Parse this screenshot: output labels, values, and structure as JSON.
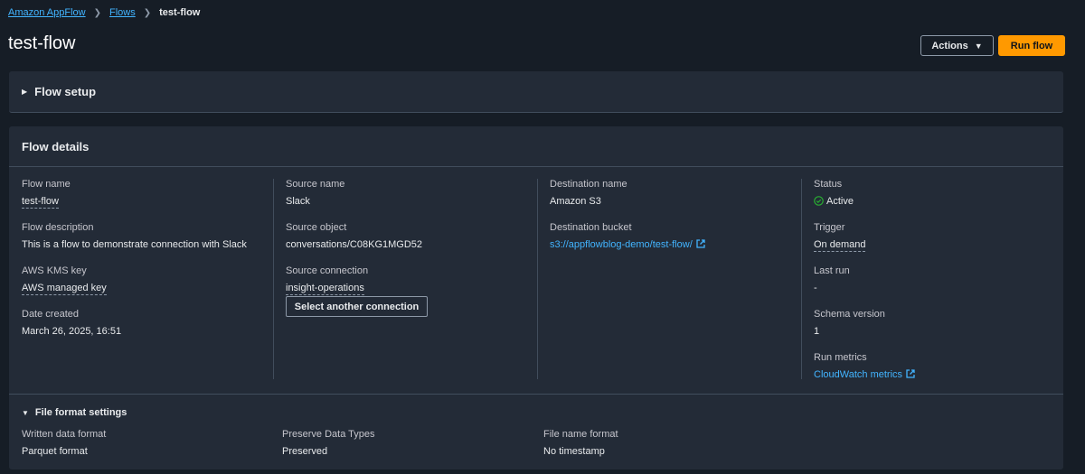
{
  "breadcrumb": {
    "items": [
      "Amazon AppFlow",
      "Flows"
    ],
    "current": "test-flow"
  },
  "page_title": "test-flow",
  "actions": {
    "actions_label": "Actions",
    "run_label": "Run flow"
  },
  "flow_setup": {
    "title": "Flow setup"
  },
  "flow_details": {
    "title": "Flow details",
    "flow_name_label": "Flow name",
    "flow_name": "test-flow",
    "flow_description_label": "Flow description",
    "flow_description": "This is a flow to demonstrate connection with Slack",
    "kms_key_label": "AWS KMS key",
    "kms_key": "AWS managed key",
    "date_created_label": "Date created",
    "date_created": "March 26, 2025, 16:51",
    "source_name_label": "Source name",
    "source_name": "Slack",
    "source_object_label": "Source object",
    "source_object": "conversations/C08KG1MGD52",
    "source_connection_label": "Source connection",
    "source_connection": "insight-operations",
    "select_connection_label": "Select another connection",
    "destination_name_label": "Destination name",
    "destination_name": "Amazon S3",
    "destination_bucket_label": "Destination bucket",
    "destination_bucket": "s3://appflowblog-demo/test-flow/",
    "status_label": "Status",
    "status": "Active",
    "trigger_label": "Trigger",
    "trigger": "On demand",
    "last_run_label": "Last run",
    "last_run": "-",
    "schema_version_label": "Schema version",
    "schema_version": "1",
    "run_metrics_label": "Run metrics",
    "run_metrics": "CloudWatch metrics"
  },
  "file_format": {
    "title": "File format settings",
    "written_format_label": "Written data format",
    "written_format": "Parquet format",
    "preserve_types_label": "Preserve Data Types",
    "preserve_types": "Preserved",
    "file_name_format_label": "File name format",
    "file_name_format": "No timestamp"
  },
  "colors": {
    "accent_link": "#42b4ff",
    "primary_button": "#ff9900",
    "status_active": "#29ad32"
  }
}
